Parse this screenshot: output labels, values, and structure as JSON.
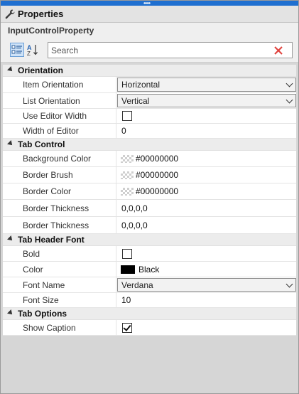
{
  "panel": {
    "title": "Properties",
    "object_name": "InputControlProperty"
  },
  "toolbar": {
    "categorized_icon": "categorized-view-icon",
    "alphabetical_icon": "alphabetical-sort-icon",
    "search_placeholder": "Search",
    "clear_icon": "clear-search-icon"
  },
  "colors": {
    "accent": "#1f6fd0",
    "clear_x": "#e0413c",
    "category_bg": "#ececec"
  },
  "categories": {
    "orientation": {
      "label": "Orientation",
      "item_orientation": {
        "name": "Item Orientation",
        "value": "Horizontal"
      },
      "list_orientation": {
        "name": "List Orientation",
        "value": "Vertical"
      },
      "use_editor_width": {
        "name": "Use Editor Width",
        "checked": false
      },
      "width_of_editor": {
        "name": "Width of Editor",
        "value": "0"
      }
    },
    "tab_control": {
      "label": "Tab Control",
      "background_color": {
        "name": "Background Color",
        "value": "#00000000"
      },
      "border_brush": {
        "name": "Border Brush",
        "value": "#00000000"
      },
      "border_color": {
        "name": "Border Color",
        "value": "#00000000"
      },
      "border_thickness_1": {
        "name": "Border Thickness",
        "value": "0,0,0,0"
      },
      "border_thickness_2": {
        "name": "Border Thickness",
        "value": "0,0,0,0"
      }
    },
    "tab_header_font": {
      "label": "Tab Header Font",
      "bold": {
        "name": "Bold",
        "checked": false
      },
      "color": {
        "name": "Color",
        "value": "Black"
      },
      "font_name": {
        "name": "Font Name",
        "value": "Verdana"
      },
      "font_size": {
        "name": "Font Size",
        "value": "10"
      }
    },
    "tab_options": {
      "label": "Tab Options",
      "show_caption": {
        "name": "Show Caption",
        "checked": true
      }
    }
  }
}
